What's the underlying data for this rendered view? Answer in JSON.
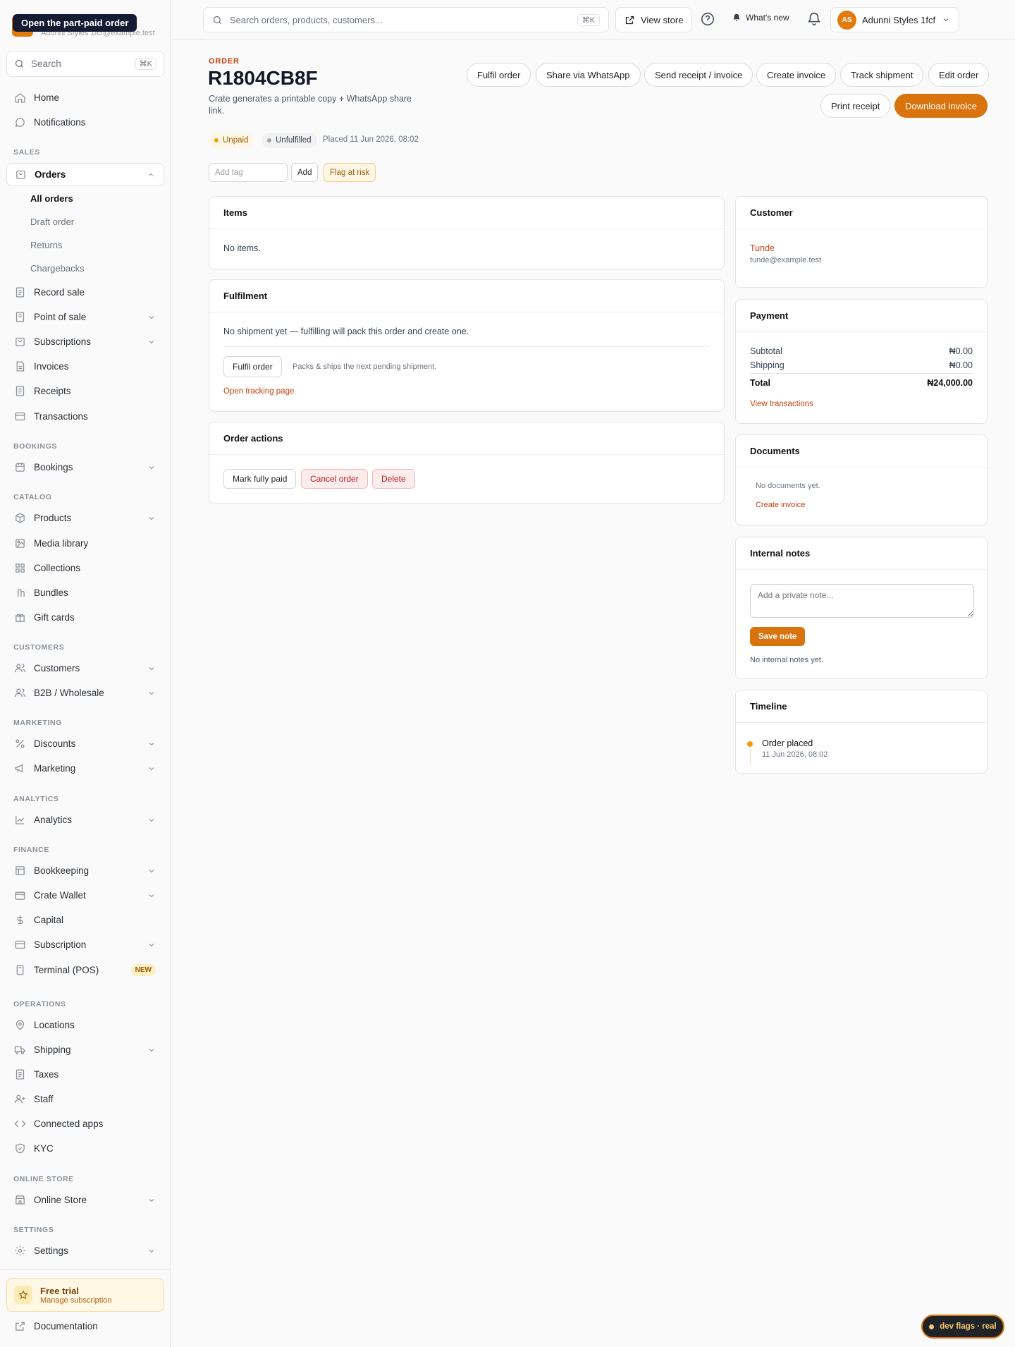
{
  "tooltip": "Open the part-paid order",
  "brand": {
    "subtitle": "Adunni Styles 1fcf@example.test"
  },
  "sidebar": {
    "search_label": "Search",
    "search_kbd": "⌘K",
    "home": "Home",
    "notifications": "Notifications",
    "sections": {
      "sales": "SALES",
      "bookings": "BOOKINGS",
      "catalog": "CATALOG",
      "customers": "CUSTOMERS",
      "marketing": "MARKETING",
      "analytics": "ANALYTICS",
      "finance": "FINANCE",
      "operations": "OPERATIONS",
      "online_store": "ONLINE STORE",
      "settings": "SETTINGS"
    },
    "orders": "Orders",
    "orders_sub": [
      "All orders",
      "Draft order",
      "Returns",
      "Chargebacks"
    ],
    "record_sale": "Record sale",
    "point_of_sale": "Point of sale",
    "subscriptions": "Subscriptions",
    "invoices": "Invoices",
    "receipts": "Receipts",
    "transactions": "Transactions",
    "bookings": "Bookings",
    "products": "Products",
    "media_library": "Media library",
    "collections": "Collections",
    "bundles": "Bundles",
    "gift_cards": "Gift cards",
    "customers": "Customers",
    "b2b": "B2B / Wholesale",
    "discounts": "Discounts",
    "marketing": "Marketing",
    "analytics": "Analytics",
    "bookkeeping": "Bookkeeping",
    "crate_wallet": "Crate Wallet",
    "capital": "Capital",
    "subscription": "Subscription",
    "terminal": "Terminal (POS)",
    "terminal_badge": "NEW",
    "locations": "Locations",
    "shipping": "Shipping",
    "taxes": "Taxes",
    "staff": "Staff",
    "connected_apps": "Connected apps",
    "kyc": "KYC",
    "online_store": "Online Store",
    "settings": "Settings",
    "trial_title": "Free trial",
    "trial_sub": "Manage subscription",
    "documentation": "Documentation"
  },
  "topbar": {
    "search_placeholder": "Search orders, products, customers...",
    "search_kbd": "⌘K",
    "view_store": "View store",
    "whats_new": "What's new",
    "avatar_initials": "AS",
    "store_name": "Adunni Styles 1fcf"
  },
  "order": {
    "eyebrow": "ORDER",
    "number": "R1804CB8F",
    "description": "Crate generates a printable copy + WhatsApp share link.",
    "actions": [
      "Fulfil order",
      "Share via WhatsApp",
      "Send receipt / invoice",
      "Create invoice",
      "Track shipment",
      "Edit order"
    ],
    "print_receipt": "Print receipt",
    "download_invoice": "Download invoice",
    "status_payment": "Unpaid",
    "status_fulfilment": "Unfulfilled",
    "placed": "Placed 11 Jun 2026, 08:02",
    "tag_placeholder": "Add tag",
    "tag_add": "Add",
    "flag_risk": "Flag at risk"
  },
  "items_card": {
    "title": "Items",
    "empty": "No items."
  },
  "fulfilment_card": {
    "title": "Fulfilment",
    "empty": "No shipment yet — fulfilling will pack this order and create one.",
    "button": "Fulfil order",
    "hint": "Packs & ships the next pending shipment.",
    "tracking_link": "Open tracking page"
  },
  "order_actions_card": {
    "title": "Order actions",
    "mark_paid": "Mark fully paid",
    "cancel": "Cancel order",
    "delete": "Delete"
  },
  "customer_card": {
    "title": "Customer",
    "name": "Tunde",
    "email": "tunde@example.test"
  },
  "payment_card": {
    "title": "Payment",
    "subtotal_label": "Subtotal",
    "subtotal": "₦0.00",
    "shipping_label": "Shipping",
    "shipping": "₦0.00",
    "total_label": "Total",
    "total": "₦24,000.00",
    "link": "View transactions"
  },
  "documents_card": {
    "title": "Documents",
    "empty": "No documents yet.",
    "link": "Create invoice"
  },
  "notes_card": {
    "title": "Internal notes",
    "placeholder": "Add a private note...",
    "save": "Save note",
    "empty": "No internal notes yet."
  },
  "timeline_card": {
    "title": "Timeline",
    "event": "Order placed",
    "time": "11 Jun 2026, 08:02"
  },
  "dev_flags": "dev flags · real",
  "colors": {
    "accent": "#d9730d",
    "danger": "#b91c1c",
    "warning": "#f59e0b"
  }
}
